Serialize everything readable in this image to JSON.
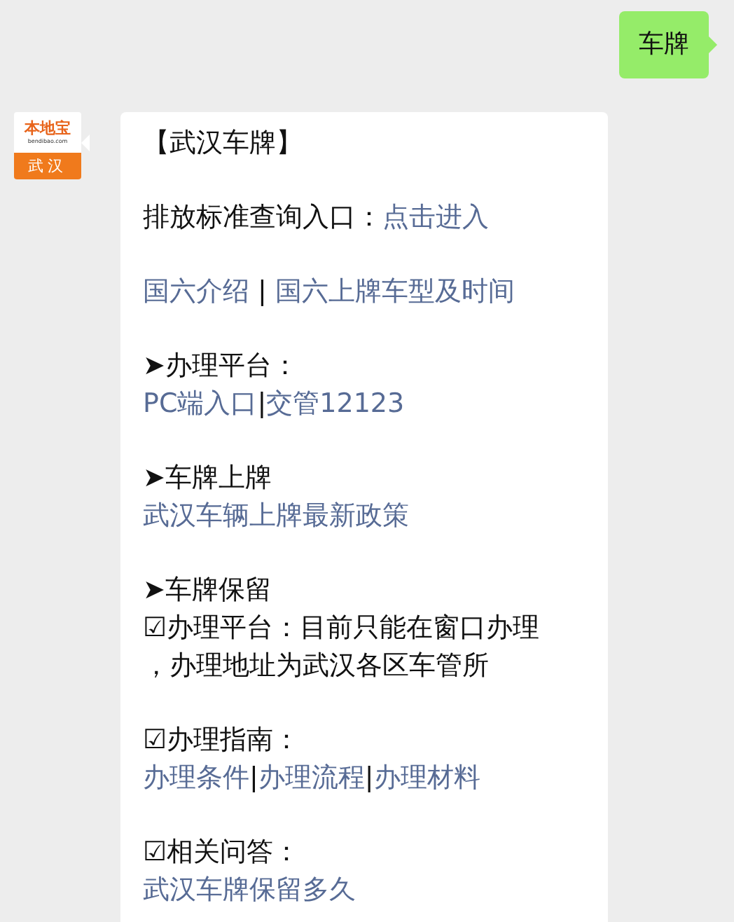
{
  "outgoing_message": {
    "text": "车牌"
  },
  "sender_avatar": {
    "brand": "本地宝",
    "domain": "bendibao.com",
    "city": "武汉"
  },
  "incoming_message": {
    "paragraphs": [
      {
        "lines": [
          [
            {
              "kind": "text",
              "text": "【武汉车牌】"
            }
          ]
        ]
      },
      {
        "lines": [
          [
            {
              "kind": "text",
              "text": "排放标准查询入口："
            },
            {
              "kind": "link",
              "text": "点击进入"
            }
          ]
        ]
      },
      {
        "lines": [
          [
            {
              "kind": "link",
              "text": "国六介绍"
            },
            {
              "kind": "text",
              "text": " | "
            },
            {
              "kind": "link",
              "text": "国六上牌车型及时间"
            }
          ]
        ]
      },
      {
        "lines": [
          [
            {
              "kind": "text",
              "text": "➤办理平台："
            }
          ],
          [
            {
              "kind": "link",
              "text": "PC端入口"
            },
            {
              "kind": "text",
              "text": "|"
            },
            {
              "kind": "link",
              "text": "交管12123"
            }
          ]
        ]
      },
      {
        "lines": [
          [
            {
              "kind": "text",
              "text": "➤车牌上牌"
            }
          ],
          [
            {
              "kind": "link",
              "text": "武汉车辆上牌最新政策"
            }
          ]
        ]
      },
      {
        "lines": [
          [
            {
              "kind": "text",
              "text": "➤车牌保留"
            }
          ],
          [
            {
              "kind": "text",
              "text": "☑办理平台：目前只能在窗口办理"
            }
          ],
          [
            {
              "kind": "text",
              "text": "，办理地址为武汉各区车管所"
            }
          ]
        ]
      },
      {
        "lines": [
          [
            {
              "kind": "text",
              "text": "☑办理指南："
            }
          ],
          [
            {
              "kind": "link",
              "text": "办理条件"
            },
            {
              "kind": "text",
              "text": "|"
            },
            {
              "kind": "link",
              "text": "办理流程"
            },
            {
              "kind": "text",
              "text": "|"
            },
            {
              "kind": "link",
              "text": "办理材料"
            }
          ]
        ]
      },
      {
        "lines": [
          [
            {
              "kind": "text",
              "text": "☑相关问答："
            }
          ],
          [
            {
              "kind": "link",
              "text": "武汉车牌保留多久"
            }
          ]
        ]
      }
    ]
  }
}
